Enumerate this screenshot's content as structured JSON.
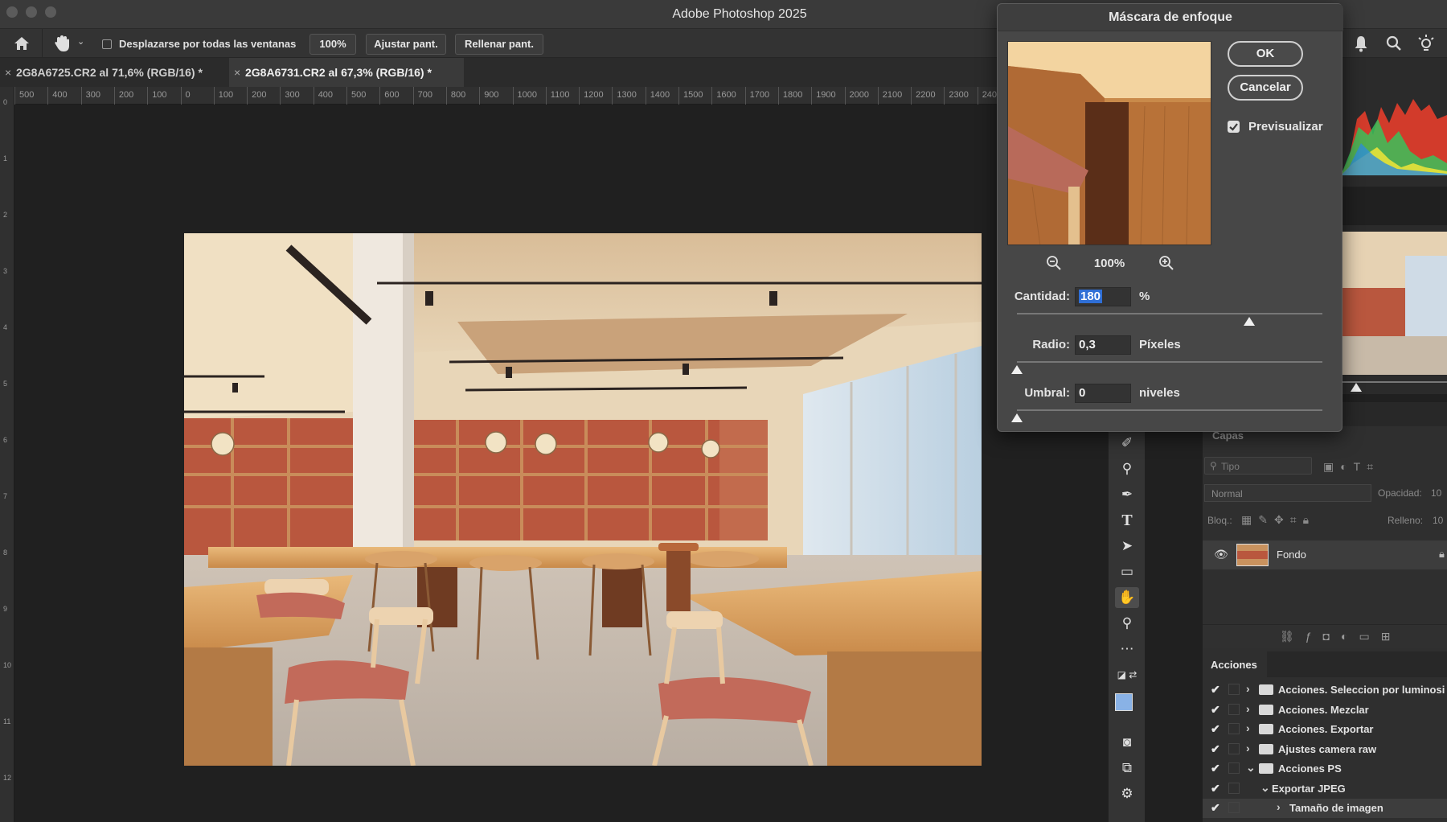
{
  "window": {
    "title": "Adobe Photoshop 2025"
  },
  "options_bar": {
    "scroll_all_label": "Desplazarse por todas las ventanas",
    "zoom_btn": "100%",
    "fit_btn": "Ajustar pant.",
    "fill_btn": "Rellenar pant."
  },
  "tabs": [
    {
      "label": "2G8A6725.CR2 al 71,6% (RGB/16) *",
      "close": "×"
    },
    {
      "label": "2G8A6731.CR2 al 67,3% (RGB/16) *",
      "close": "×"
    }
  ],
  "ruler": {
    "h_ticks": [
      "500",
      "400",
      "300",
      "200",
      "100",
      "0",
      "100",
      "200",
      "300",
      "400",
      "500",
      "600",
      "700",
      "800",
      "900",
      "1000",
      "1100",
      "1200",
      "1300",
      "1400",
      "1500",
      "1600",
      "1700",
      "1800",
      "1900",
      "2000",
      "2100",
      "2200",
      "2300",
      "240"
    ],
    "v_ticks": [
      "0",
      "1",
      "2",
      "3",
      "4",
      "5",
      "6",
      "7",
      "8",
      "9",
      "10",
      "11",
      "12"
    ]
  },
  "dialog": {
    "title": "Máscara de enfoque",
    "ok": "OK",
    "cancel": "Cancelar",
    "preview_label": "Previsualizar",
    "preview_checked": true,
    "zoom_level": "100%",
    "amount_label": "Cantidad:",
    "amount_value": "180",
    "amount_unit": "%",
    "amount_slider": 0.76,
    "radius_label": "Radio:",
    "radius_value": "0,3",
    "radius_unit": "Píxeles",
    "radius_slider": 0.0,
    "threshold_label": "Umbral:",
    "threshold_value": "0",
    "threshold_unit": "niveles",
    "threshold_slider": 0.0
  },
  "layers": {
    "tab": "Capas",
    "search_placeholder": "Tipo",
    "blend_mode": "Normal",
    "opacity_label": "Opacidad:",
    "opacity_value": "10",
    "lock_label": "Bloq.:",
    "fill_label": "Relleno:",
    "fill_value": "10",
    "layer_name": "Fondo"
  },
  "actions": {
    "tab": "Acciones",
    "items": [
      {
        "label": "Acciones. Seleccion por luminosi",
        "type": "set"
      },
      {
        "label": "Acciones. Mezclar",
        "type": "set"
      },
      {
        "label": "Acciones. Exportar",
        "type": "set"
      },
      {
        "label": "Ajustes camera raw",
        "type": "set"
      },
      {
        "label": "Acciones PS",
        "type": "set-open"
      },
      {
        "label": "Exportar JPEG",
        "type": "action"
      },
      {
        "label": "Tamaño de imagen",
        "type": "step"
      }
    ]
  },
  "colors": {
    "accent": "#2f6fd6",
    "dialog_bg": "#474747",
    "app_bg": "#202020"
  }
}
